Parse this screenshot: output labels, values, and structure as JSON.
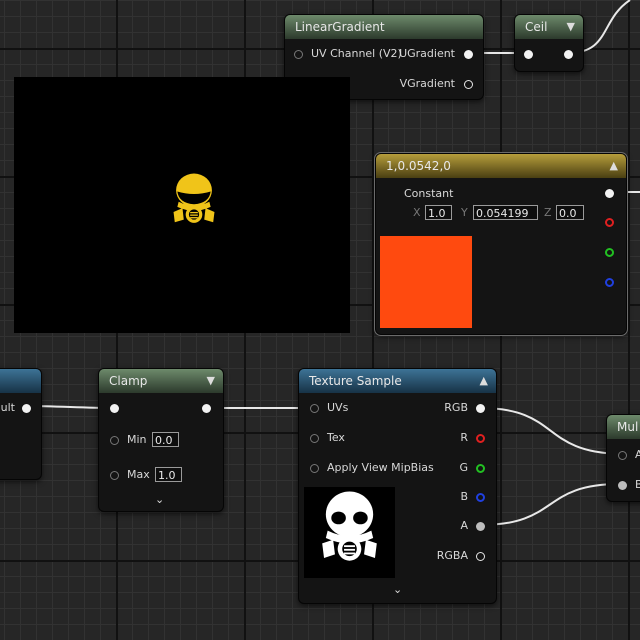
{
  "nodes": {
    "linear_gradient": {
      "title": "LinearGradient",
      "input_uv": "UV Channel (V2)",
      "out_u": "UGradient",
      "out_v": "VGradient"
    },
    "ceil": {
      "title": "Ceil"
    },
    "constant": {
      "title": "1,0.0542,0",
      "label": "Constant",
      "x_label": "X",
      "x_value": "1.0",
      "y_label": "Y",
      "y_value": "0.054199",
      "z_label": "Z",
      "z_value": "0.0",
      "swatch_color": "#ff4a0f"
    },
    "left_partial": {
      "out_label": "ult"
    },
    "clamp": {
      "title": "Clamp",
      "min_label": "Min",
      "min_value": "0.0",
      "max_label": "Max",
      "max_value": "1.0"
    },
    "texture_sample": {
      "title": "Texture Sample",
      "in_uvs": "UVs",
      "in_tex": "Tex",
      "in_mip": "Apply View MipBias",
      "out_rgb": "RGB",
      "out_r": "R",
      "out_g": "G",
      "out_b": "B",
      "out_a": "A",
      "out_rgba": "RGBA"
    },
    "multiply": {
      "title": "Mul",
      "in_a": "A",
      "in_b": "B"
    }
  },
  "preview": {
    "icon": "gas-mask-icon",
    "icon_color": "#f0c419"
  },
  "colors": {
    "accent_gold": "#f0c419",
    "constant_orange": "#ff4a0f"
  }
}
